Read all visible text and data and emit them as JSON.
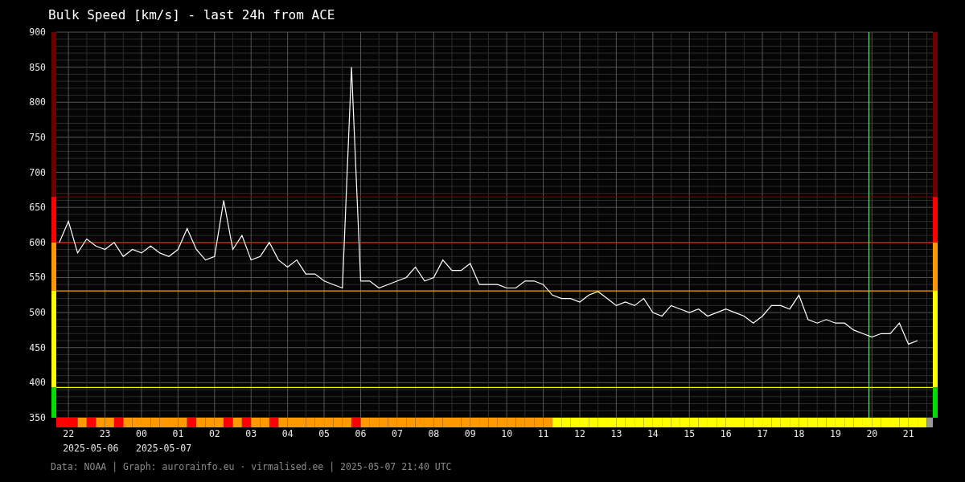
{
  "title": "Bulk Speed [km/s] - last 24h from ACE",
  "chart": {
    "chart_data": {
      "type": "line",
      "categories": [
        null,
        "22",
        null,
        null,
        null,
        "23",
        null,
        null,
        null,
        "00",
        null,
        null,
        null,
        "01",
        null,
        null,
        null,
        "02",
        null,
        null,
        null,
        "03",
        null,
        null,
        null,
        "04",
        null,
        null,
        null,
        "05",
        null,
        null,
        null,
        "06",
        null,
        null,
        null,
        "07",
        null,
        null,
        null,
        "08",
        null,
        null,
        null,
        "09",
        null,
        null,
        null,
        "10",
        null,
        null,
        null,
        "11",
        null,
        null,
        null,
        "12",
        null,
        null,
        null,
        "13",
        null,
        null,
        null,
        "14",
        null,
        null,
        null,
        "15",
        null,
        null,
        null,
        "16",
        null,
        null,
        null,
        "17",
        null,
        null,
        null,
        "18",
        null,
        null,
        null,
        "19",
        null,
        null,
        null,
        "20",
        null,
        null,
        null,
        "21",
        null,
        null
      ],
      "series": [
        {
          "color": "#ffffff",
          "values": [
            600,
            630,
            585,
            605,
            595,
            590,
            600,
            580,
            590,
            585,
            595,
            585,
            580,
            590,
            620,
            590,
            575,
            580,
            660,
            590,
            610,
            575,
            580,
            600,
            575,
            565,
            575,
            555,
            555,
            545,
            540,
            535,
            850,
            545,
            545,
            535,
            540,
            545,
            550,
            565,
            545,
            550,
            575,
            560,
            560,
            570,
            540,
            540,
            540,
            535,
            535,
            545,
            545,
            540,
            525,
            520,
            520,
            515,
            525,
            530,
            520,
            510,
            515,
            510,
            520,
            500,
            495,
            510,
            505,
            500,
            505,
            495,
            500,
            505,
            500,
            495,
            485,
            495,
            510,
            510,
            505,
            525,
            490,
            485,
            490,
            485,
            485,
            475,
            470,
            465,
            470,
            470,
            485,
            455,
            460,
            null
          ]
        }
      ],
      "ylim": [
        350,
        900
      ],
      "yticks": [
        350,
        400,
        450,
        500,
        550,
        600,
        650,
        700,
        750,
        800,
        850,
        900
      ],
      "ref_lines": [
        {
          "axis": "y",
          "value": 665,
          "color": "#6b0000"
        },
        {
          "axis": "y",
          "value": 600,
          "color": "#ff0000"
        },
        {
          "axis": "y",
          "value": 531,
          "color": "#ff9900"
        },
        {
          "axis": "y",
          "value": 393,
          "color": "#ffff00"
        }
      ],
      "grid": true,
      "annotations": [
        "2025-05-06",
        "2025-05-07"
      ]
    }
  },
  "footer": "Data: NOAA | Graph: aurorainfo.eu · virmalised.ee | 2025-05-07 21:40 UTC"
}
